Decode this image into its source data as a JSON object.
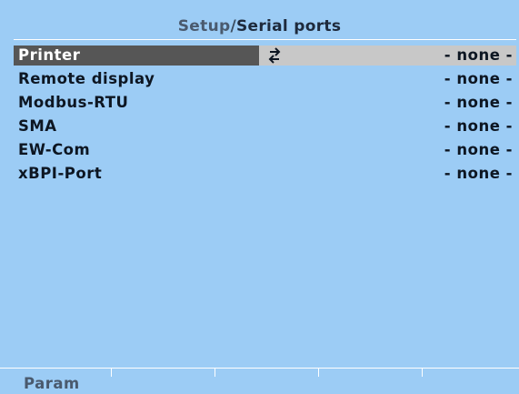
{
  "header": {
    "path": "Setup",
    "separator": "/",
    "page": "Serial ports"
  },
  "ports": [
    {
      "name": "Printer",
      "value": "- none -",
      "selected": true
    },
    {
      "name": "Remote display",
      "value": "- none -"
    },
    {
      "name": "Modbus-RTU",
      "value": "- none -"
    },
    {
      "name": "SMA",
      "value": "- none -"
    },
    {
      "name": "EW-Com",
      "value": "- none -"
    },
    {
      "name": "xBPI-Port",
      "value": "- none -"
    }
  ],
  "softkeys": [
    {
      "label": "Param"
    },
    {
      "label": ""
    },
    {
      "label": ""
    },
    {
      "label": ""
    },
    {
      "label": ""
    }
  ],
  "icons": {
    "selected_row": "swap-arrows-icon"
  },
  "colors": {
    "background": "#9cccf5",
    "selection_name_bg": "#565656",
    "selection_row_bg": "#c8c8c8",
    "text": "#0d1622"
  }
}
